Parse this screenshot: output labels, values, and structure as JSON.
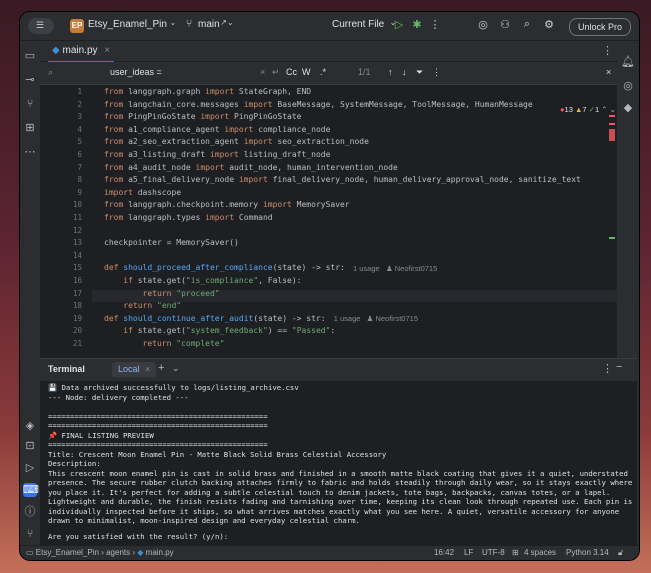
{
  "titlebar": {
    "project_badge": "EP",
    "project_name": "Etsy_Enamel_Pin",
    "branch": "main",
    "run_config": "Current File",
    "unlock_label": "Unlock Pro"
  },
  "editor_tab": {
    "label": "main.py"
  },
  "find": {
    "query": "user_ideas =",
    "opt_case": "Cc",
    "opt_word": "W",
    "opt_regex": ".*",
    "match_count": "1/1"
  },
  "inspections": {
    "errors": "13",
    "warnings": "7",
    "weak": "1"
  },
  "code_lines": [
    {
      "n": "1",
      "t": "from langgraph.graph import StateGraph, END"
    },
    {
      "n": "2",
      "t": "from langchain_core.messages import BaseMessage, SystemMessage, ToolMessage, HumanMessage"
    },
    {
      "n": "3",
      "t": "from PingPinGoState import PingPinGoState"
    },
    {
      "n": "4",
      "t": "from a1_compliance_agent import compliance_node"
    },
    {
      "n": "5",
      "t": "from a2_seo_extraction_agent import seo_extraction_node"
    },
    {
      "n": "6",
      "t": "from a3_listing_draft import listing_draft_node"
    },
    {
      "n": "7",
      "t": "from a4_audit_node import audit_node, human_intervention_node"
    },
    {
      "n": "8",
      "t": "from a5_final_delivery_node import final_delivery_node, human_delivery_approval_node, sanitize_text"
    },
    {
      "n": "9",
      "t": "import dashscope"
    },
    {
      "n": "10",
      "t": "from langgraph.checkpoint.memory import MemorySaver"
    },
    {
      "n": "11",
      "t": "from langgraph.types import Command"
    },
    {
      "n": "12",
      "t": ""
    },
    {
      "n": "13",
      "t": "checkpointer = MemorySaver()"
    },
    {
      "n": "14",
      "t": ""
    },
    {
      "n": "15",
      "t": "def should_proceed_after_compliance(state) -> str:"
    },
    {
      "n": "16",
      "t": "    if state.get(\"is_compliance\", False):"
    },
    {
      "n": "17",
      "t": "        return \"proceed\""
    },
    {
      "n": "18",
      "t": "    return \"end\""
    },
    {
      "n": "19",
      "t": "def should_continue_after_audit(state) -> str:"
    },
    {
      "n": "20",
      "t": "    if state.get(\"system_feedback\") == \"Passed\":"
    },
    {
      "n": "21",
      "t": "        return \"complete\""
    }
  ],
  "usage_hints": {
    "line15": "1 usage",
    "line15_author": "Neofirst0715",
    "line19": "1 usage",
    "line19_author": "Neofirst0715"
  },
  "terminal": {
    "title": "Terminal",
    "tab_label": "Local",
    "lines": [
      "💾 Data archived successfully to logs/listing_archive.csv",
      "--- Node: delivery completed ---",
      "",
      "==================================================",
      "==================================================",
      "📌 FINAL LISTING PREVIEW",
      "==================================================",
      "Title: Crescent Moon Enamel Pin - Matte Black Solid Brass Celestial Accessory",
      "Description:"
    ],
    "description": "This crescent moon enamel pin is cast in solid brass and finished in a smooth matte black coating that gives it a quiet, understated presence. The secure rubber clutch backing attaches firmly to fabric and holds steadily through daily wear, so it stays exactly where you place it. It's perfect for adding a subtle celestial touch to denim jackets, tote bags, backpacks, canvas totes, or a lapel. Lightweight and durable, the finish resists fading and tarnishing over time, keeping its clean look through repeated use. Each pin is individually inspected before it ships, so what arrives matches exactly what you see here. A quiet, versatile accessory for anyone drawn to minimalist, moon-inspired design and everyday celestial charm.",
    "prompt": "Are you satisfied with the result? (y/n):"
  },
  "statusbar": {
    "crumb_project": "Etsy_Enamel_Pin",
    "crumb_folder": "agents",
    "crumb_file": "main.py",
    "position": "16:42",
    "line_sep": "LF",
    "encoding": "UTF-8",
    "indent": "4 spaces",
    "interpreter": "Python 3.14"
  }
}
